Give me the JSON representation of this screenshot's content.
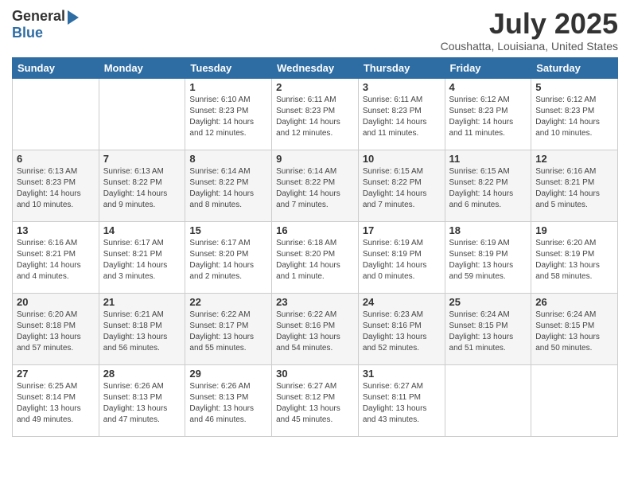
{
  "logo": {
    "general": "General",
    "blue": "Blue"
  },
  "title": "July 2025",
  "location": "Coushatta, Louisiana, United States",
  "weekdays": [
    "Sunday",
    "Monday",
    "Tuesday",
    "Wednesday",
    "Thursday",
    "Friday",
    "Saturday"
  ],
  "weeks": [
    [
      {
        "day": "",
        "info": ""
      },
      {
        "day": "",
        "info": ""
      },
      {
        "day": "1",
        "info": "Sunrise: 6:10 AM\nSunset: 8:23 PM\nDaylight: 14 hours\nand 12 minutes."
      },
      {
        "day": "2",
        "info": "Sunrise: 6:11 AM\nSunset: 8:23 PM\nDaylight: 14 hours\nand 12 minutes."
      },
      {
        "day": "3",
        "info": "Sunrise: 6:11 AM\nSunset: 8:23 PM\nDaylight: 14 hours\nand 11 minutes."
      },
      {
        "day": "4",
        "info": "Sunrise: 6:12 AM\nSunset: 8:23 PM\nDaylight: 14 hours\nand 11 minutes."
      },
      {
        "day": "5",
        "info": "Sunrise: 6:12 AM\nSunset: 8:23 PM\nDaylight: 14 hours\nand 10 minutes."
      }
    ],
    [
      {
        "day": "6",
        "info": "Sunrise: 6:13 AM\nSunset: 8:23 PM\nDaylight: 14 hours\nand 10 minutes."
      },
      {
        "day": "7",
        "info": "Sunrise: 6:13 AM\nSunset: 8:22 PM\nDaylight: 14 hours\nand 9 minutes."
      },
      {
        "day": "8",
        "info": "Sunrise: 6:14 AM\nSunset: 8:22 PM\nDaylight: 14 hours\nand 8 minutes."
      },
      {
        "day": "9",
        "info": "Sunrise: 6:14 AM\nSunset: 8:22 PM\nDaylight: 14 hours\nand 7 minutes."
      },
      {
        "day": "10",
        "info": "Sunrise: 6:15 AM\nSunset: 8:22 PM\nDaylight: 14 hours\nand 7 minutes."
      },
      {
        "day": "11",
        "info": "Sunrise: 6:15 AM\nSunset: 8:22 PM\nDaylight: 14 hours\nand 6 minutes."
      },
      {
        "day": "12",
        "info": "Sunrise: 6:16 AM\nSunset: 8:21 PM\nDaylight: 14 hours\nand 5 minutes."
      }
    ],
    [
      {
        "day": "13",
        "info": "Sunrise: 6:16 AM\nSunset: 8:21 PM\nDaylight: 14 hours\nand 4 minutes."
      },
      {
        "day": "14",
        "info": "Sunrise: 6:17 AM\nSunset: 8:21 PM\nDaylight: 14 hours\nand 3 minutes."
      },
      {
        "day": "15",
        "info": "Sunrise: 6:17 AM\nSunset: 8:20 PM\nDaylight: 14 hours\nand 2 minutes."
      },
      {
        "day": "16",
        "info": "Sunrise: 6:18 AM\nSunset: 8:20 PM\nDaylight: 14 hours\nand 1 minute."
      },
      {
        "day": "17",
        "info": "Sunrise: 6:19 AM\nSunset: 8:19 PM\nDaylight: 14 hours\nand 0 minutes."
      },
      {
        "day": "18",
        "info": "Sunrise: 6:19 AM\nSunset: 8:19 PM\nDaylight: 13 hours\nand 59 minutes."
      },
      {
        "day": "19",
        "info": "Sunrise: 6:20 AM\nSunset: 8:19 PM\nDaylight: 13 hours\nand 58 minutes."
      }
    ],
    [
      {
        "day": "20",
        "info": "Sunrise: 6:20 AM\nSunset: 8:18 PM\nDaylight: 13 hours\nand 57 minutes."
      },
      {
        "day": "21",
        "info": "Sunrise: 6:21 AM\nSunset: 8:18 PM\nDaylight: 13 hours\nand 56 minutes."
      },
      {
        "day": "22",
        "info": "Sunrise: 6:22 AM\nSunset: 8:17 PM\nDaylight: 13 hours\nand 55 minutes."
      },
      {
        "day": "23",
        "info": "Sunrise: 6:22 AM\nSunset: 8:16 PM\nDaylight: 13 hours\nand 54 minutes."
      },
      {
        "day": "24",
        "info": "Sunrise: 6:23 AM\nSunset: 8:16 PM\nDaylight: 13 hours\nand 52 minutes."
      },
      {
        "day": "25",
        "info": "Sunrise: 6:24 AM\nSunset: 8:15 PM\nDaylight: 13 hours\nand 51 minutes."
      },
      {
        "day": "26",
        "info": "Sunrise: 6:24 AM\nSunset: 8:15 PM\nDaylight: 13 hours\nand 50 minutes."
      }
    ],
    [
      {
        "day": "27",
        "info": "Sunrise: 6:25 AM\nSunset: 8:14 PM\nDaylight: 13 hours\nand 49 minutes."
      },
      {
        "day": "28",
        "info": "Sunrise: 6:26 AM\nSunset: 8:13 PM\nDaylight: 13 hours\nand 47 minutes."
      },
      {
        "day": "29",
        "info": "Sunrise: 6:26 AM\nSunset: 8:13 PM\nDaylight: 13 hours\nand 46 minutes."
      },
      {
        "day": "30",
        "info": "Sunrise: 6:27 AM\nSunset: 8:12 PM\nDaylight: 13 hours\nand 45 minutes."
      },
      {
        "day": "31",
        "info": "Sunrise: 6:27 AM\nSunset: 8:11 PM\nDaylight: 13 hours\nand 43 minutes."
      },
      {
        "day": "",
        "info": ""
      },
      {
        "day": "",
        "info": ""
      }
    ]
  ]
}
